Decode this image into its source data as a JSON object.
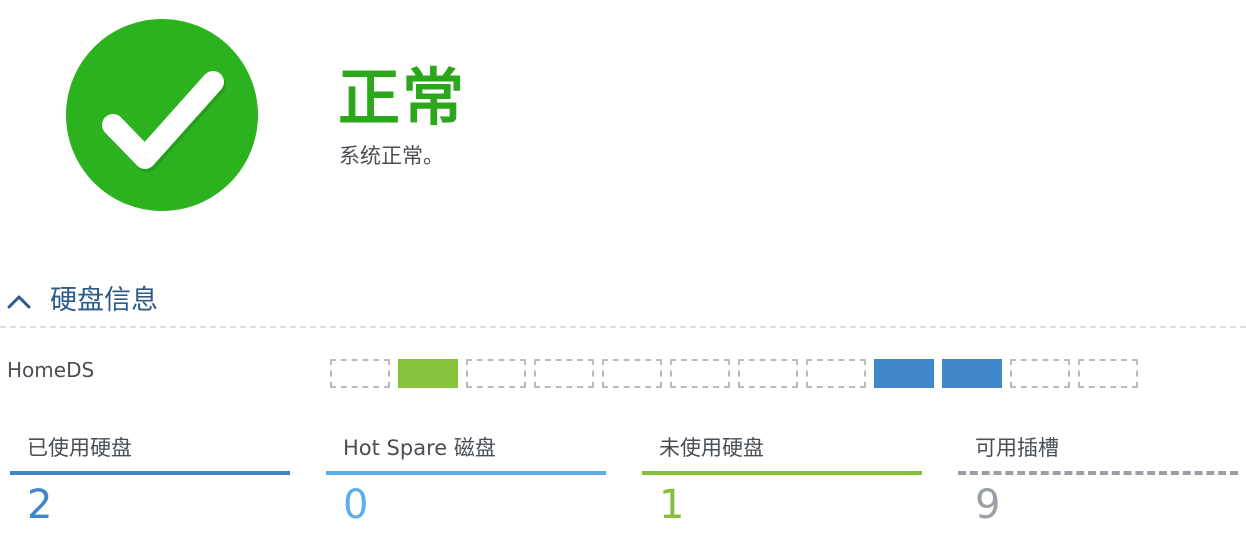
{
  "status": {
    "title": "正常",
    "description": "系统正常。",
    "icon": "check-circle-icon",
    "color": "#2cb11f"
  },
  "section": {
    "title": "硬盘信息",
    "collapse_icon": "chevron-up-icon",
    "title_color": "#2d5b88"
  },
  "device": {
    "name": "HomeDS",
    "slots": [
      "empty",
      "unused",
      "empty",
      "empty",
      "empty",
      "empty",
      "empty",
      "empty",
      "used",
      "used",
      "empty",
      "empty"
    ]
  },
  "stats": [
    {
      "label": "已使用硬盘",
      "value": "2",
      "color": "#3f85cb",
      "style": "solid"
    },
    {
      "label": "Hot Spare 磁盘",
      "value": "0",
      "color": "#5dadea",
      "style": "solid"
    },
    {
      "label": "未使用硬盘",
      "value": "1",
      "color": "#84c13a",
      "style": "solid"
    },
    {
      "label": "可用插槽",
      "value": "9",
      "color": "#9a9fa5",
      "style": "dashed"
    }
  ]
}
